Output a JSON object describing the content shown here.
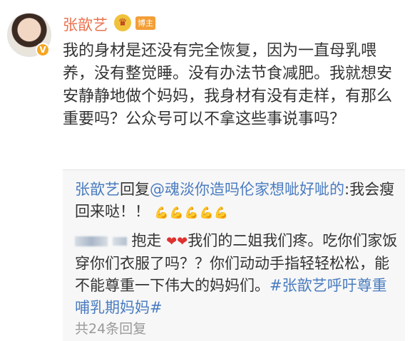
{
  "post": {
    "username": "张歆艺",
    "vip_mark": "V",
    "host_badge": "博主",
    "text": "我的身材是还没有完全恢复，因为一直母乳喂养，没有整觉睡。没有办法节食减肥。我就想安安静静地做个妈妈，我身材有没有走样，有那么重要吗？公众号可以不拿这些事说事吗？"
  },
  "quote": {
    "reply": {
      "author": "张歆艺",
      "reply_word": "回复",
      "mention": "@魂淡你造吗伦家想呲好呲的",
      "text_after": ":我会瘦回来哒！！",
      "emoji": "💪💪💪💪💪"
    },
    "comment": {
      "action": "抱走",
      "hearts": "❤❤",
      "text": "我们的二姐我们疼。吃你们家饭穿你们衣服了吗？？你们动动手指轻轻松松，能不能尊重一下伟大的妈妈们。",
      "hashtag": "#张歆艺呼吁尊重哺乳期妈妈#"
    },
    "cutoff_text": "共24条回复"
  },
  "colors": {
    "username": "#eb7350",
    "link": "#4a7cc0",
    "text": "#333333",
    "quote_bg": "#f7f7f7",
    "badge": "#f39e37"
  }
}
